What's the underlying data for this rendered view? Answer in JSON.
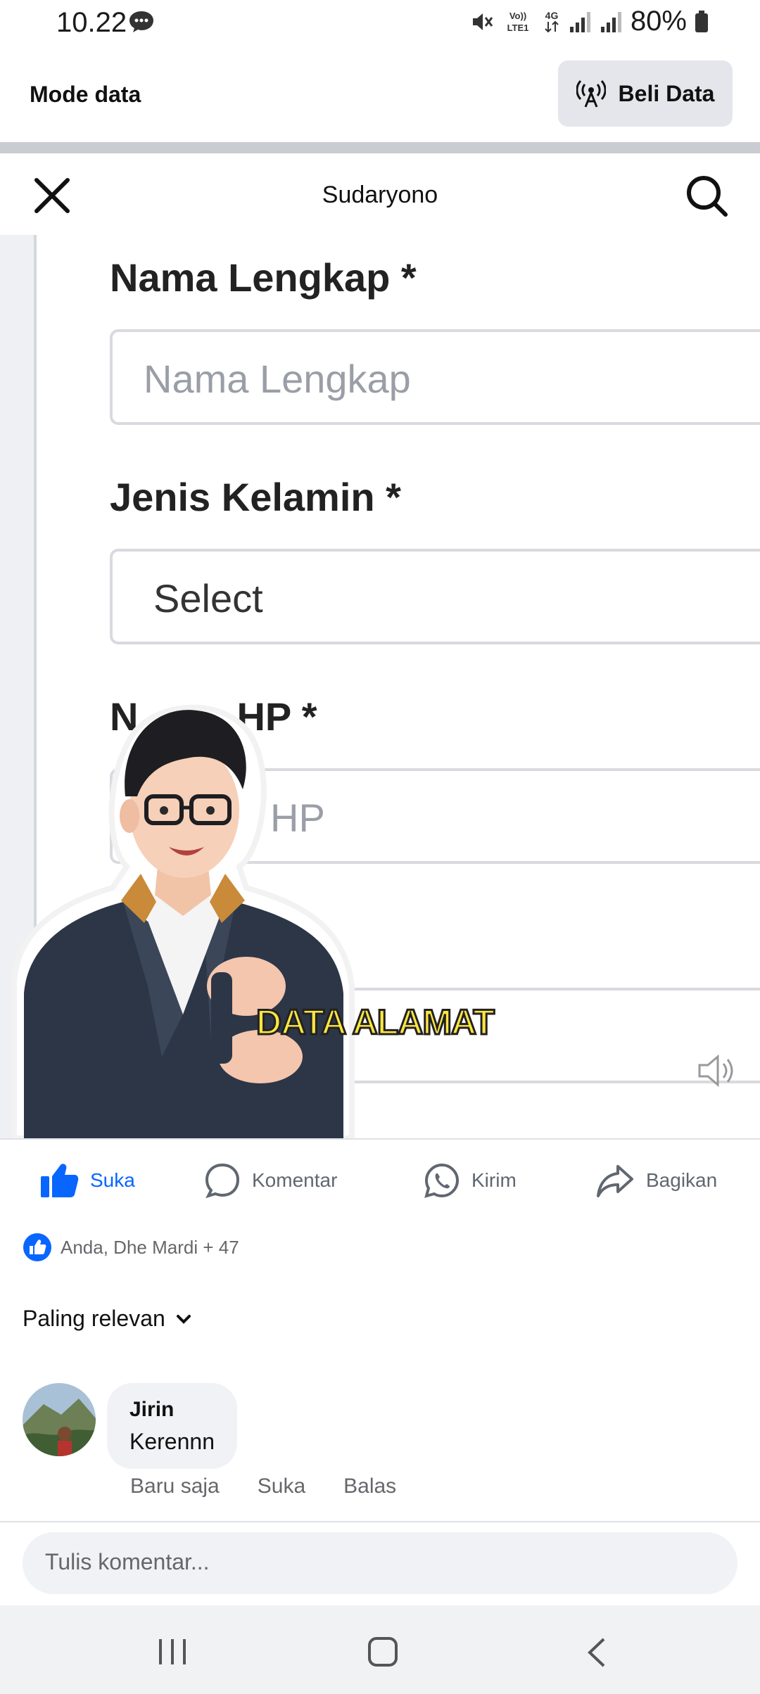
{
  "status_bar": {
    "time": "10.22",
    "battery": "80%",
    "network": "4G",
    "volte": "Vo)) LTE1"
  },
  "data_bar": {
    "label": "Mode data",
    "buy_button": "Beli Data"
  },
  "header": {
    "title": "Sudaryono"
  },
  "video": {
    "fields": [
      {
        "label": "Nama Lengkap",
        "required_mark": "*",
        "placeholder": "Nama Lengkap"
      },
      {
        "label": "Jenis Kelamin",
        "required_mark": "*",
        "value": "Select"
      },
      {
        "label_visible_start": "N",
        "label_visible_end": "HP",
        "required_mark": "*",
        "placeholder_visible": "HP"
      }
    ],
    "caption": "DATA ALAMAT"
  },
  "actions": {
    "like": "Suka",
    "comment": "Komentar",
    "send": "Kirim",
    "share": "Bagikan"
  },
  "reactions": {
    "text": "Anda, Dhe Mardi + 47"
  },
  "sort": {
    "label": "Paling relevan"
  },
  "comment": {
    "author": "Jirin",
    "text": "Kerennn",
    "time": "Baru saja",
    "like": "Suka",
    "reply": "Balas"
  },
  "composer": {
    "placeholder": "Tulis komentar..."
  },
  "colors": {
    "accent": "#0866ff",
    "caption_fill": "#ffe640",
    "divider": "#c9ccd1"
  }
}
